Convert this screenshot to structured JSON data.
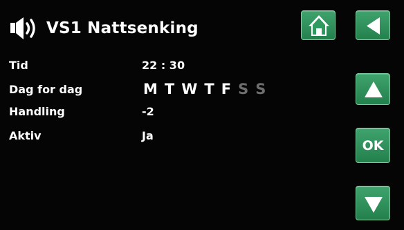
{
  "header": {
    "title": "VS1 Nattsenking",
    "speaker_icon": "speaker-icon",
    "home_icon": "home-icon",
    "back_icon": "back-arrow-icon"
  },
  "rows": [
    {
      "label": "Tid",
      "value": "22 : 30"
    },
    {
      "label": "Dag for dag",
      "value": ""
    },
    {
      "label": "Handling",
      "value": "-2"
    },
    {
      "label": "Aktiv",
      "value": "Ja"
    }
  ],
  "days": [
    {
      "letter": "M",
      "active": true
    },
    {
      "letter": "T",
      "active": true
    },
    {
      "letter": "W",
      "active": true
    },
    {
      "letter": "T",
      "active": true
    },
    {
      "letter": "F",
      "active": true
    },
    {
      "letter": "S",
      "active": false
    },
    {
      "letter": "S",
      "active": false
    }
  ],
  "side_buttons": {
    "up_icon": "arrow-up-icon",
    "ok_label": "OK",
    "down_icon": "arrow-down-icon"
  },
  "colors": {
    "background": "#050505",
    "button_green": "#2f9a5f",
    "text": "#ffffff",
    "inactive_day": "#6e6e6e"
  }
}
